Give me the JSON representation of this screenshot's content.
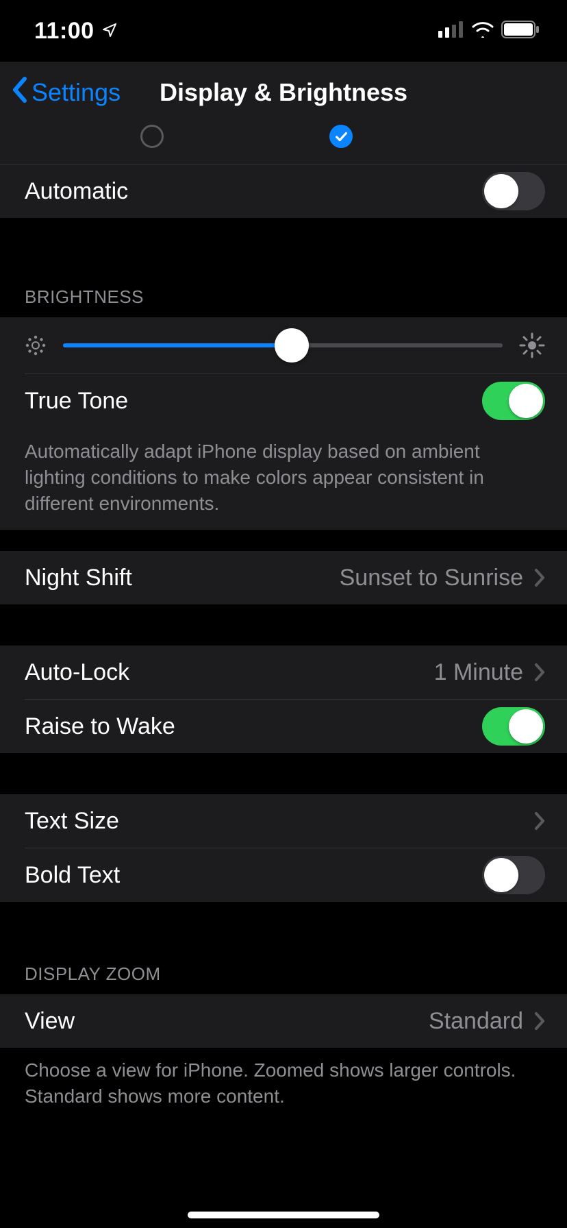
{
  "status": {
    "time": "11:00"
  },
  "nav": {
    "back": "Settings",
    "title": "Display & Brightness"
  },
  "automatic": {
    "label": "Automatic",
    "on": false
  },
  "brightness": {
    "header": "BRIGHTNESS",
    "value_percent": 52
  },
  "truetone": {
    "label": "True Tone",
    "on": true,
    "footer": "Automatically adapt iPhone display based on ambient lighting conditions to make colors appear consistent in different environments."
  },
  "night_shift": {
    "label": "Night Shift",
    "value": "Sunset to Sunrise"
  },
  "auto_lock": {
    "label": "Auto-Lock",
    "value": "1 Minute"
  },
  "raise_to_wake": {
    "label": "Raise to Wake",
    "on": true
  },
  "text_size": {
    "label": "Text Size"
  },
  "bold_text": {
    "label": "Bold Text",
    "on": false
  },
  "display_zoom": {
    "header": "DISPLAY ZOOM",
    "view_label": "View",
    "view_value": "Standard",
    "footer": "Choose a view for iPhone. Zoomed shows larger controls. Standard shows more content."
  }
}
